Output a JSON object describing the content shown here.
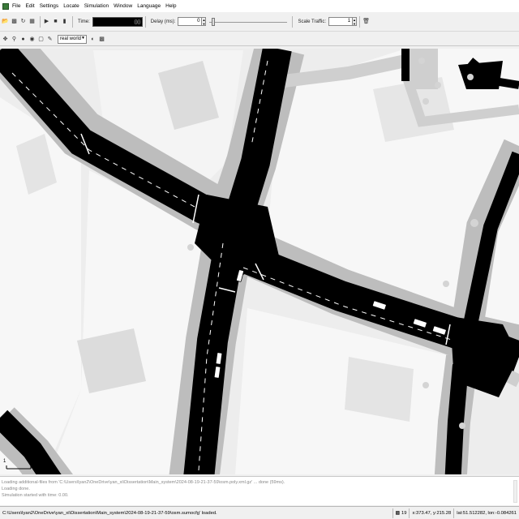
{
  "menu": {
    "items": [
      {
        "label": "File"
      },
      {
        "label": "Edit"
      },
      {
        "label": "Settings"
      },
      {
        "label": "Locate"
      },
      {
        "label": "Simulation"
      },
      {
        "label": "Window"
      },
      {
        "label": "Language"
      },
      {
        "label": "Help"
      }
    ]
  },
  "toolbar": {
    "time_label": "Time:",
    "time_value": "00",
    "delay_label": "Delay (ms):",
    "delay_value": "0",
    "scale_label": "Scale Traffic:",
    "scale_value": "1"
  },
  "view": {
    "scheme_value": "real world"
  },
  "map": {
    "scale_label": "1",
    "colors": {
      "road": "#000000",
      "sidewalk": "#bdbdbd",
      "block": "#f7f7f7",
      "building": "#dcdcdc",
      "background": "#ededed"
    }
  },
  "log": {
    "lines": [
      "Loading additional-files from 'C:\\Users\\lyan2\\OneDrive\\yan_xi\\Dissertation\\Main_system\\2024-08-19-21-37-59\\osm.poly.xml.gz' ... done (59ms).",
      "Loading done.",
      "Simulation started with time: 0.00."
    ]
  },
  "status": {
    "message": "C:\\Users\\lyan2\\OneDrive\\yan_xi\\Dissertation\\Main_system\\2024-08-19-21-37-59\\osm.sumocfg' loaded.",
    "zoom": "19",
    "coords": "x:373.47, y:215.28",
    "geo": "lat:51.512282, lon:-0.084261"
  }
}
